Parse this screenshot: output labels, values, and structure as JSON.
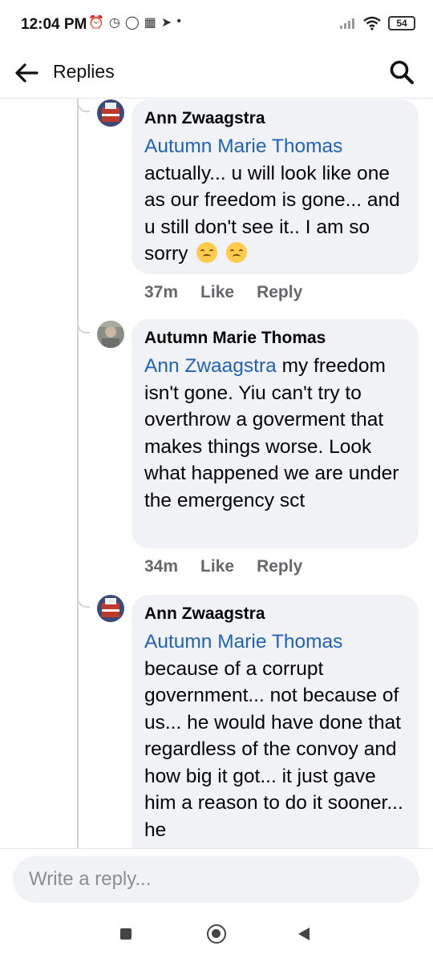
{
  "status_bar": {
    "time": "12:04 PM",
    "battery": "54",
    "notification_icons": [
      "alarm-off-icon",
      "alarm-icon",
      "whatsapp-icon",
      "app-grid-icon",
      "telegram-icon",
      "dot-icon"
    ],
    "right_icons": [
      "signal-icon",
      "wifi-icon",
      "battery-icon"
    ]
  },
  "header": {
    "title": "Replies",
    "back_icon": "arrow-left-icon",
    "search_icon": "search-icon"
  },
  "comments": [
    {
      "author": "Ann Zwaagstra",
      "mention": "Autumn Marie Thomas",
      "text": "actually... u will look like one as our freedom is gone... and u still don't see it..  I am so sorry",
      "emojis": [
        "disappointed-face-emoji",
        "pensive-face-emoji"
      ],
      "time": "37m",
      "like": "Like",
      "reply": "Reply"
    },
    {
      "author": "Autumn Marie Thomas",
      "mention": "Ann Zwaagstra",
      "text": "my freedom isn't gone. Yiu can't try to overthrow a goverment that makes things worse. Look what happened we are under the emergency sct",
      "time": "34m",
      "like": "Like",
      "reply": "Reply"
    },
    {
      "author": "Ann Zwaagstra",
      "mention": "Autumn Marie Thomas",
      "text": "because of a corrupt government... not because of us... he would have done that regardless of the convoy and how big it got... it just gave him a reason to do it sooner... he"
    }
  ],
  "composer": {
    "placeholder": "Write a reply..."
  },
  "colors": {
    "mention": "#2161b6",
    "bubble": "#f0f2f5",
    "meta_text": "#65676b"
  }
}
